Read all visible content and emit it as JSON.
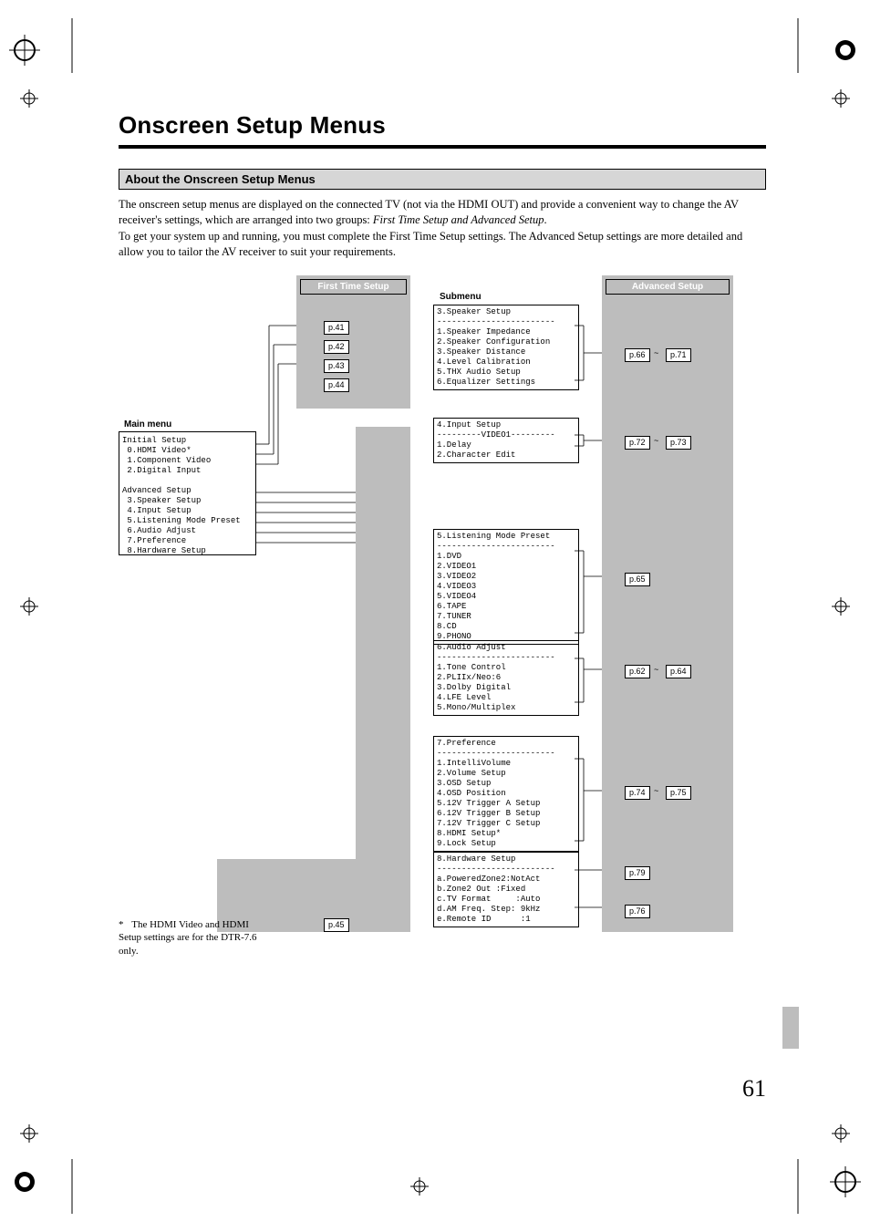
{
  "page_title": "Onscreen Setup Menus",
  "section_heading": "About the Onscreen Setup Menus",
  "para1a": "The onscreen setup menus are displayed on the connected TV (not via the HDMI OUT) and provide a convenient way to change the AV receiver's settings, which are arranged into two groups: ",
  "para1b_italic": "First Time Setup and Advanced Setup",
  "para1c": ".",
  "para2": "To get your system up and running, you must complete the First Time Setup settings. The Advanced Setup settings are more detailed and allow you to tailor the AV receiver to suit your requirements.",
  "labels": {
    "first_time_setup": "First Time Setup",
    "advanced_setup": "Advanced Setup",
    "submenu": "Submenu",
    "main_menu": "Main menu"
  },
  "main_menu_text": "Initial Setup\n 0.HDMI Video*\n 1.Component Video\n 2.Digital Input\n\nAdvanced Setup\n 3.Speaker Setup\n 4.Input Setup\n 5.Listening Mode Preset\n 6.Audio Adjust\n 7.Preference\n 8.Hardware Setup",
  "first_prefs": {
    "a": "p.41",
    "b": "p.42",
    "c": "p.43",
    "d": "p.44"
  },
  "chart_data": [
    {
      "type": "table",
      "title": "3.Speaker Setup",
      "items": [
        "1.Speaker Impedance",
        "2.Speaker Configuration",
        "3.Speaker Distance",
        "4.Level Calibration",
        "5.THX Audio Setup",
        "6.Equalizer Settings"
      ],
      "page_from": "p.66",
      "page_to": "p.71"
    },
    {
      "type": "table",
      "title": "4.Input Setup",
      "subheader": "---------VIDEO1---------",
      "items": [
        "1.Delay",
        "2.Character Edit"
      ],
      "page_from": "p.72",
      "page_to": "p.73"
    },
    {
      "type": "table",
      "title": "5.Listening Mode Preset",
      "items": [
        "1.DVD",
        "2.VIDEO1",
        "3.VIDEO2",
        "4.VIDEO3",
        "5.VIDEO4",
        "6.TAPE",
        "7.TUNER",
        "8.CD",
        "9.PHONO"
      ],
      "page_single": "p.65"
    },
    {
      "type": "table",
      "title": "6.Audio Adjust",
      "items": [
        "1.Tone Control",
        "2.PLIIx/Neo:6",
        "3.Dolby Digital",
        "4.LFE Level",
        "5.Mono/Multiplex"
      ],
      "page_from": "p.62",
      "page_to": "p.64"
    },
    {
      "type": "table",
      "title": "7.Preference",
      "items": [
        "1.IntelliVolume",
        "2.Volume Setup",
        "3.OSD Setup",
        "4.OSD Position",
        "5.12V Trigger A Setup",
        "6.12V Trigger B Setup",
        "7.12V Trigger C Setup",
        "8.HDMI Setup*",
        "9.Lock Setup"
      ],
      "page_from": "p.74",
      "page_to": "p.75"
    },
    {
      "type": "table",
      "title": "8.Hardware Setup",
      "items": [
        "a.PoweredZone2:NotAct",
        "b.Zone2 Out :Fixed",
        "c.TV Format     :Auto",
        "d.AM Freq. Step: 9kHz",
        "e.Remote ID      :1"
      ],
      "page_a": "p.79",
      "page_b": "p.76"
    }
  ],
  "bottom_pref": "p.45",
  "footnote_star": "*",
  "footnote": "The HDMI Video and HDMI Setup settings are for the DTR-7.6 only.",
  "page_number": "61",
  "tilde": "~"
}
